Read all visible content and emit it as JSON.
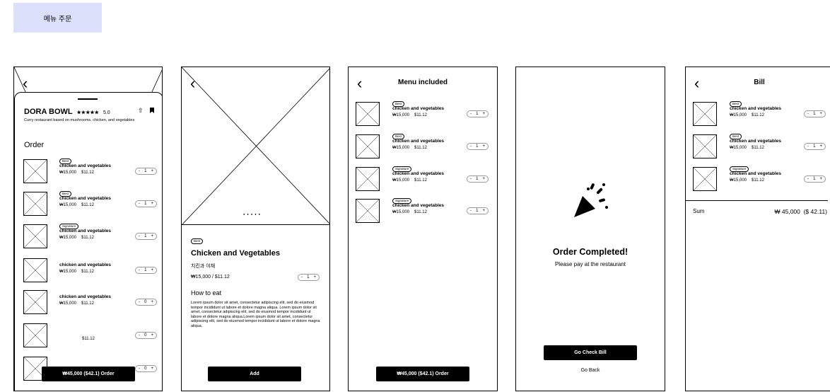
{
  "tag_label": "메뉴 주문",
  "screen1": {
    "restaurant_name": "DORA BOWL",
    "stars": "★★★★★",
    "rating": "5.0",
    "description": "Curry restaurant based on mushrooms, chicken, and vegetables",
    "order_heading": "Order",
    "items": [
      {
        "badge": "Best",
        "name": "chicken and vegetables",
        "price_krw": "₩15,000",
        "price_usd": "$11.12",
        "qty": "1"
      },
      {
        "badge": "Best",
        "name": "chicken and vegetables",
        "price_krw": "₩15,000",
        "price_usd": "$11.12",
        "qty": "1"
      },
      {
        "badge": "Signature",
        "name": "chicken and vegetables",
        "price_krw": "₩15,000",
        "price_usd": "$11.12",
        "qty": "1"
      },
      {
        "badge": "",
        "name": "chicken and vegetables",
        "price_krw": "₩15,000",
        "price_usd": "$11.12",
        "qty": "1"
      },
      {
        "badge": "",
        "name": "chicken and vegetables",
        "price_krw": "₩15,000",
        "price_usd": "$11.12",
        "qty": "0"
      },
      {
        "badge": "",
        "name": "",
        "price_krw": "",
        "price_usd": "$11.12",
        "qty": "0"
      },
      {
        "badge": "",
        "name": "",
        "price_krw": "",
        "price_usd": "",
        "qty": "0"
      }
    ],
    "order_button": "₩45,000 ($42.1) Order"
  },
  "screen2": {
    "badge": "Best",
    "title": "Chicken and Vegetables",
    "subtitle": "치킨과 야채",
    "price": "₩15,000 / $11.12",
    "qty": "1",
    "how_to_eat_heading": "How to eat",
    "how_to_eat_text": "Lorem ipsum dolor sit amet, consectetur adipiscing elit, sed do eiusmod tempor incididunt ut labore et dolore magna aliqua. Lorem ipsum dolor sit amet, consectetur adipiscing elit, sed do eiusmod tempor incididunt ut labore et dolore magna aliqua.Lorem ipsum dolor sit amet, consectetur adipiscing elit, sed do eiusmod tempor incididunt ut labore et dolore magna aliqua.",
    "add_button": "Add"
  },
  "screen3": {
    "title": "Menu included",
    "items": [
      {
        "badge": "Best",
        "name": "chicken and vegetables",
        "price_krw": "₩15,000",
        "price_usd": "$11.12",
        "qty": "1"
      },
      {
        "badge": "Best",
        "name": "chicken and vegetables",
        "price_krw": "₩15,000",
        "price_usd": "$11.12",
        "qty": "1"
      },
      {
        "badge": "Signature",
        "name": "chicken and vegetables",
        "price_krw": "₩15,000",
        "price_usd": "$11.12",
        "qty": "1"
      },
      {
        "badge": "Signature",
        "name": "chicken and vegetables",
        "price_krw": "₩15,000",
        "price_usd": "$11.12",
        "qty": "1"
      }
    ],
    "order_button": "₩45,000 ($42.1) Order"
  },
  "screen4": {
    "title": "Order Completed!",
    "subtitle": "Please pay at the restaurant",
    "check_bill_button": "Go Check Bill",
    "go_back_link": "Go Back"
  },
  "screen5": {
    "title": "Bill",
    "items": [
      {
        "badge": "Best",
        "name": "chicken and vegetables",
        "price_krw": "₩15,000",
        "price_usd": "$11.12",
        "qty": "1"
      },
      {
        "badge": "Best",
        "name": "chicken and vegetables",
        "price_krw": "₩15,000",
        "price_usd": "$11.12",
        "qty": "1"
      },
      {
        "badge": "Signature",
        "name": "chicken and vegetables",
        "price_krw": "₩15,000",
        "price_usd": "$11.12",
        "qty": "1"
      }
    ],
    "sum_label": "Sum",
    "sum_value": "₩ 45,000  ($ 42.11)"
  }
}
